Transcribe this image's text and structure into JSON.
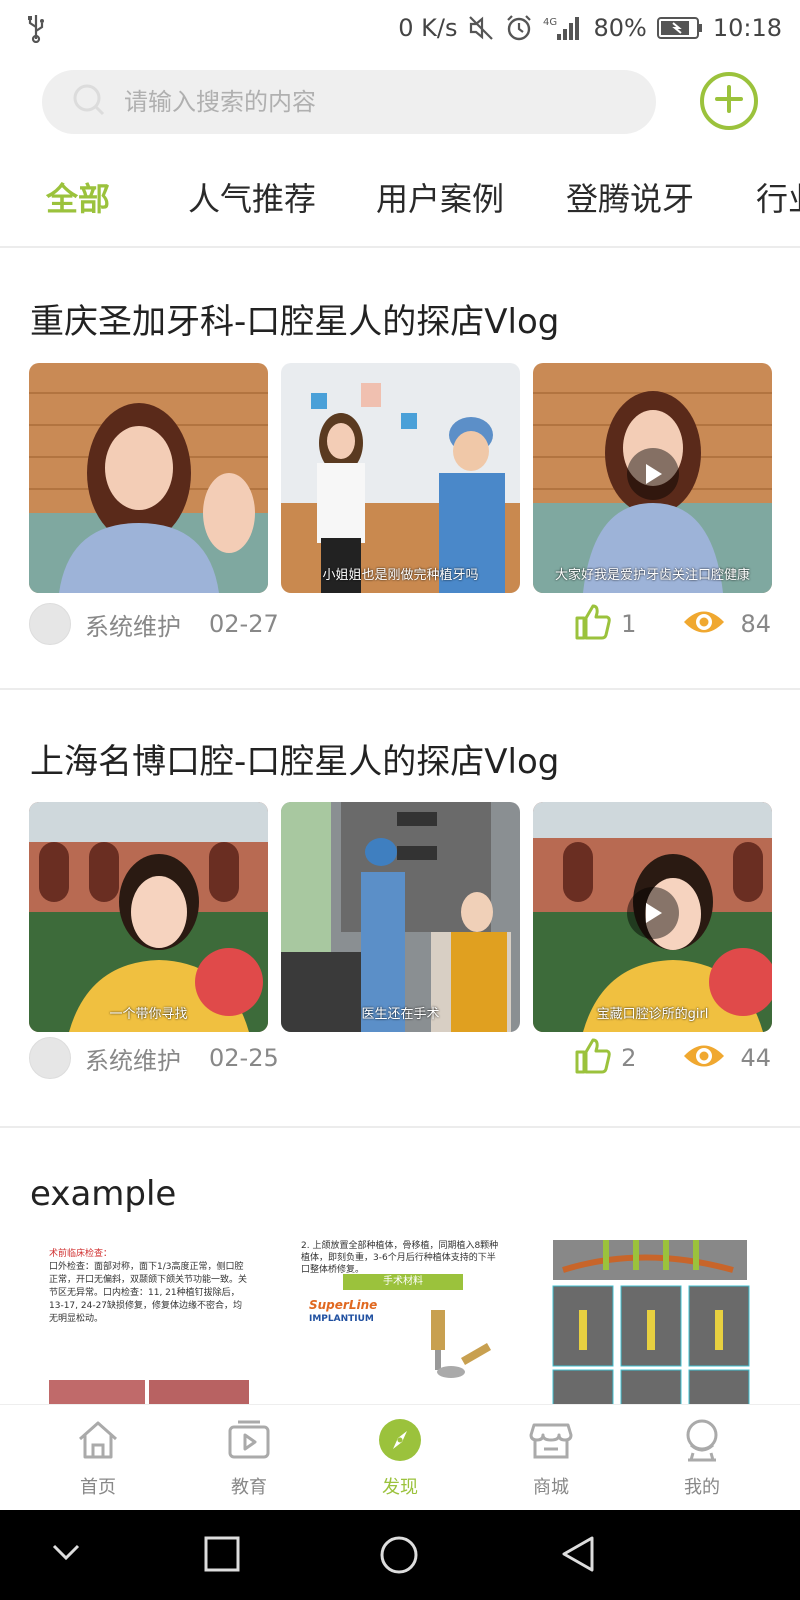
{
  "status_bar": {
    "speed": "0 K/s",
    "network": "4G",
    "battery": "80%",
    "time": "10:18",
    "icons": [
      "usb-icon",
      "mute-icon",
      "alarm-icon",
      "signal-icon",
      "battery-icon"
    ]
  },
  "search": {
    "placeholder": "请输入搜索的内容"
  },
  "tabs": [
    "全部",
    "人气推荐",
    "用户案例",
    "登腾说牙",
    "行业"
  ],
  "active_tab": "全部",
  "posts": [
    {
      "title": "重庆圣加牙科-口腔星人的探店Vlog",
      "captions": [
        "",
        "小姐姐也是刚做完种植牙吗",
        "大家好我是爱护牙齿关注口腔健康"
      ],
      "author": "系统维护",
      "date": "02-27",
      "likes": "1",
      "views": "84"
    },
    {
      "title": "上海名博口腔-口腔星人的探店Vlog",
      "captions": [
        "一个带你寻找",
        "医生还在手术",
        "宝藏口腔诊所的girl"
      ],
      "author": "系统维护",
      "date": "02-25",
      "likes": "2",
      "views": "44"
    },
    {
      "title": "example",
      "doc_text": {
        "heading": "术前临床检查：",
        "body": "口外检查：面部对称，面下1/3高度正常，侧口腔正常，开口无偏斜，双颞颌下颌关节功能一致。关节区无异常。口内检查：11, 21种植钉拔除后，13-17, 24-27缺损修复，修复体边缘不密合，均无明显松动。",
        "material_label": "手术材料",
        "brand": "SuperLine",
        "product": "IMPLANTIUM",
        "top_text": "2. 上颌放置全部种植体，骨移植，同期植入8颗种植体，即刻负重，3-6个月后行种植体支持的下半口整体桥修复。"
      }
    }
  ],
  "bottom_nav": [
    {
      "label": "首页",
      "icon": "home-icon"
    },
    {
      "label": "教育",
      "icon": "video-icon"
    },
    {
      "label": "发现",
      "icon": "compass-icon"
    },
    {
      "label": "商城",
      "icon": "shop-icon"
    },
    {
      "label": "我的",
      "icon": "profile-icon"
    }
  ],
  "active_nav": "发现",
  "colors": {
    "accent": "#9bc23c",
    "eye": "#f0a830"
  }
}
